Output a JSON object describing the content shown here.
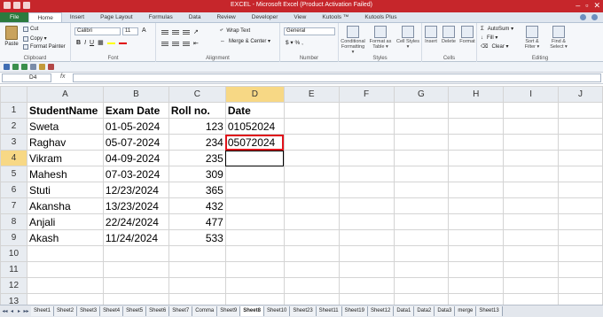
{
  "window": {
    "title": "EXCEL - Microsoft Excel (Product Activation Failed)",
    "controls": [
      "–",
      "▫",
      "✕"
    ]
  },
  "ribbon_tabs": [
    "File",
    "Home",
    "Insert",
    "Page Layout",
    "Formulas",
    "Data",
    "Review",
    "Developer",
    "View",
    "Kutools ™",
    "Kutools Plus"
  ],
  "ribbon": {
    "clipboard": {
      "paste": "Paste",
      "cut": "Cut",
      "copy": "Copy ▾",
      "format_painter": "Format Painter",
      "label": "Clipboard"
    },
    "font": {
      "name": "Calibri",
      "size": "11",
      "bold": "B",
      "italic": "I",
      "underline": "U",
      "label": "Font"
    },
    "alignment": {
      "wrap": "Wrap Text",
      "merge": "Merge & Center ▾",
      "label": "Alignment"
    },
    "number": {
      "format": "General",
      "symbols": "$ ▾ % ,",
      "label": "Number"
    },
    "styles": {
      "cond": "Conditional Formatting ▾",
      "table": "Format as Table ▾",
      "cell": "Cell Styles ▾",
      "label": "Styles"
    },
    "cells": {
      "insert": "Insert",
      "delete": "Delete",
      "format": "Format",
      "label": "Cells"
    },
    "editing": {
      "autosum": "AutoSum ▾",
      "fill": "Fill ▾",
      "clear": "Clear ▾",
      "sort": "Sort & Filter ▾",
      "find": "Find & Select ▾",
      "label": "Editing"
    }
  },
  "formula_bar": {
    "name_box": "D4",
    "fx": "fx",
    "value": ""
  },
  "columns": [
    "A",
    "B",
    "C",
    "D",
    "E",
    "F",
    "G",
    "H",
    "I",
    "J"
  ],
  "rows": [
    {
      "n": "1",
      "a": "StudentName",
      "b": "Exam Date",
      "c": "Roll no.",
      "d": "Date"
    },
    {
      "n": "2",
      "a": "Sweta",
      "b": " 01-05-2024",
      "c": "123",
      "d": "01052024"
    },
    {
      "n": "3",
      "a": "Raghav",
      "b": " 05-07-2024",
      "c": "234",
      "d": "05072024"
    },
    {
      "n": "4",
      "a": "Vikram",
      "b": " 04-09-2024",
      "c": "235",
      "d": ""
    },
    {
      "n": "5",
      "a": "Mahesh",
      "b": " 07-03-2024",
      "c": "309",
      "d": ""
    },
    {
      "n": "6",
      "a": "Stuti",
      "b": "12/23/2024",
      "c": "365",
      "d": ""
    },
    {
      "n": "7",
      "a": "Akansha",
      "b": "13/23/2024",
      "c": "432",
      "d": ""
    },
    {
      "n": "8",
      "a": "Anjali",
      "b": "22/24/2024",
      "c": "477",
      "d": ""
    },
    {
      "n": "9",
      "a": "Akash",
      "b": "11/24/2024",
      "c": "533",
      "d": ""
    },
    {
      "n": "10",
      "a": "",
      "b": "",
      "c": "",
      "d": ""
    },
    {
      "n": "11",
      "a": "",
      "b": "",
      "c": "",
      "d": ""
    },
    {
      "n": "12",
      "a": "",
      "b": "",
      "c": "",
      "d": ""
    },
    {
      "n": "13",
      "a": "",
      "b": "",
      "c": "",
      "d": ""
    }
  ],
  "sheet_nav": [
    "◂◂",
    "◂",
    "▸",
    "▸▸"
  ],
  "sheet_tabs": [
    "Sheet1",
    "Sheet2",
    "Sheet3",
    "Sheet4",
    "Sheet5",
    "Sheet6",
    "Sheet7",
    "Comma",
    "Sheet9",
    "Sheet8",
    "Sheet10",
    "Sheet23",
    "Sheet11",
    "Sheet19",
    "Sheet12",
    "Data1",
    "Data2",
    "Data3",
    "merge",
    "Sheet13"
  ],
  "active_sheet": "Sheet8",
  "colors": {
    "title_bar": "#c6262b",
    "file_tab": "#2b7a3e",
    "highlight_border": "#e0131b",
    "selected_header": "#f7d885"
  }
}
